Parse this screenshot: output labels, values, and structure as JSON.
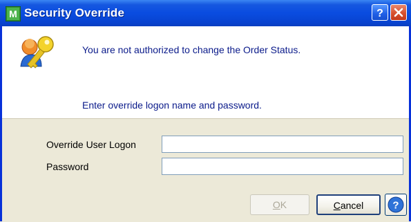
{
  "window": {
    "title": "Security Override",
    "app_icon_glyph": "M"
  },
  "titlebar_buttons": {
    "help_glyph": "?",
    "close_glyph": "✕"
  },
  "message": {
    "line1": "You are not authorized to change the Order Status.",
    "line2": "Enter override logon name and password."
  },
  "form": {
    "logon_label": "Override User Logon",
    "logon_value": "",
    "password_label": "Password",
    "password_value": ""
  },
  "buttons": {
    "ok_label_access": "O",
    "ok_label_rest": "K",
    "cancel_label_access": "C",
    "cancel_label_rest": "ancel",
    "help_glyph": "?"
  },
  "colors": {
    "title_bar": "#0a4ce0",
    "message_text": "#0a1a8a",
    "dialog_face": "#ece9d8"
  }
}
